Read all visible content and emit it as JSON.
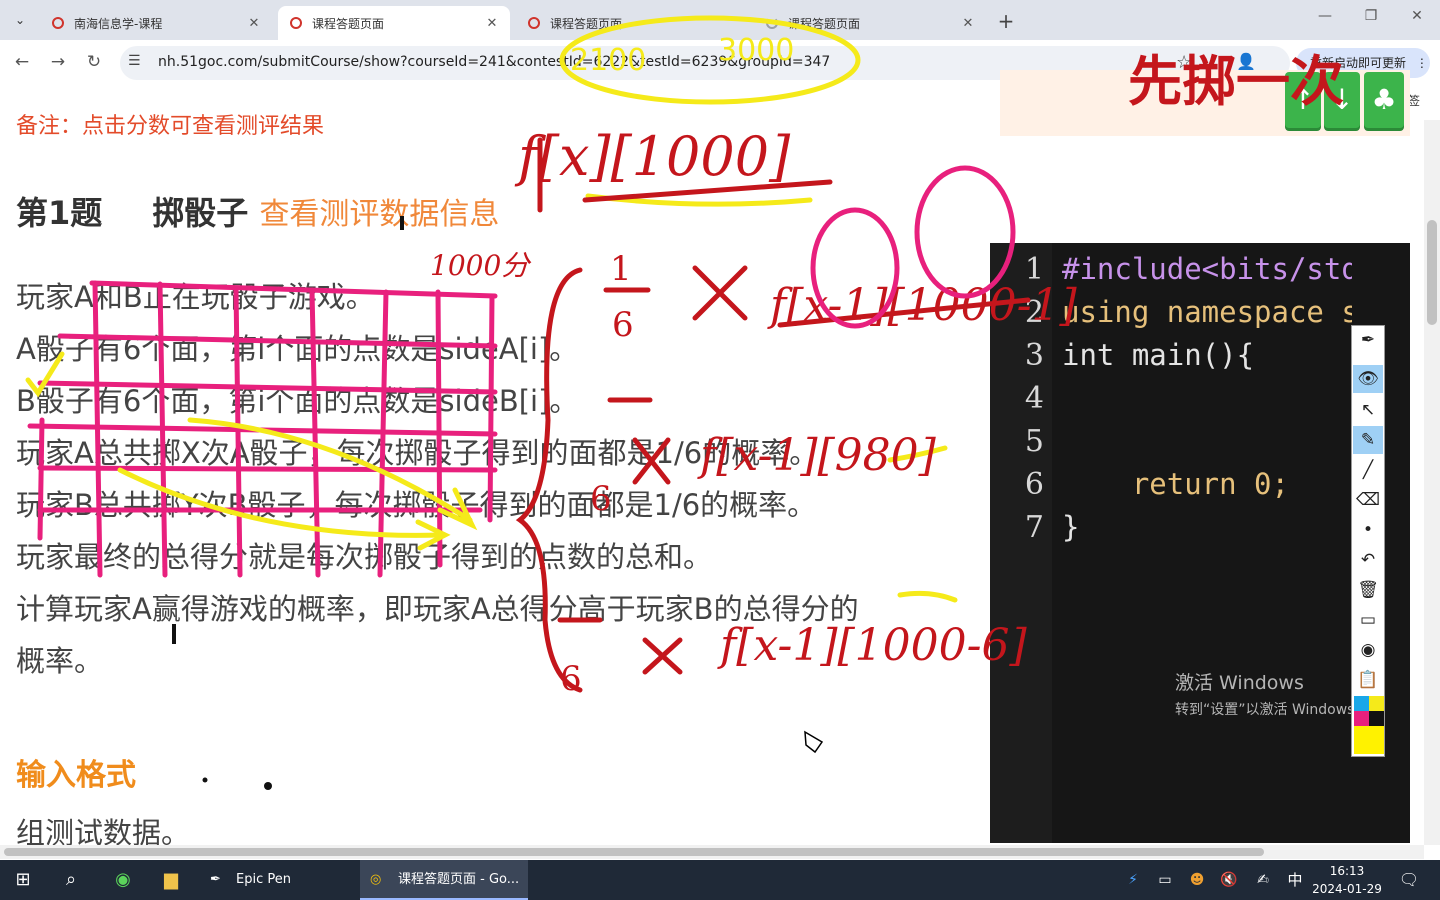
{
  "browser": {
    "tabs": [
      {
        "label": "南海信息学-课程"
      },
      {
        "label": "课程答题页面"
      },
      {
        "label": "课程答题页面"
      },
      {
        "label": "课程答题页面"
      }
    ],
    "url": "nh.51goc.com/submitCourse/show?courseId=241&contestId=6222&testId=6239&groupId=347",
    "update_button": "重新启动即可更新",
    "bookmarks_label": "所有书签"
  },
  "page": {
    "note": "备注：点击分数可查看测评结果",
    "question_number": "第1题",
    "question_title": "掷骰子",
    "view_data_link": "查看测评数据信息",
    "paragraphs": [
      "玩家A和B正在玩骰子游戏。",
      "A骰子有6个面，第i个面的点数是sideA[i]。",
      "B骰子有6个面，第i个面的点数是sideB[i]。",
      "玩家A总共掷X次A骰子，每次掷骰子得到的面都是1/6的概率。",
      "玩家B总共掷Y次B骰子，每次掷骰子得到的面都是1/6的概率。",
      "玩家最终的总得分就是每次掷骰子得到的点数的总和。",
      "计算玩家A赢得游戏的概率，即玩家A总得分高于玩家B的总得分的",
      "概率。"
    ],
    "input_heading": "输入格式",
    "input_text": "组测试数据。"
  },
  "editor": {
    "buttons": {
      "up": "↑",
      "down": "↓",
      "extra": "♣"
    },
    "line_numbers": [
      "1",
      "2",
      "3",
      "4",
      "5",
      "6",
      "7"
    ],
    "lines": [
      "#include<bits/stdc++.h>",
      "using namespace std;",
      "int main(){",
      "",
      "",
      "    return 0;",
      "}"
    ]
  },
  "watermark": {
    "line1": "激活 Windows",
    "line2": "转到“设置”以激活 Windows。"
  },
  "taskbar": {
    "apps": [
      {
        "label": "Epic Pen"
      },
      {
        "label": "课程答题页面 - Go..."
      }
    ],
    "time": "16:13",
    "date": "2024-01-29",
    "ime": "中"
  },
  "annotations": {
    "top_right": "先掷一次",
    "formula_top": "f[x][1000]",
    "nums": [
      "1000分",
      "980"
    ],
    "dims": [
      "2100",
      "3000"
    ]
  },
  "colors": {
    "note": "#e34b2a",
    "link": "#f0883a",
    "heading": "#f08c1c",
    "green_button": "#3cb44b",
    "ink_red": "#c4161c",
    "ink_pink": "#e8207d",
    "ink_yellow": "#f5ea1a"
  }
}
